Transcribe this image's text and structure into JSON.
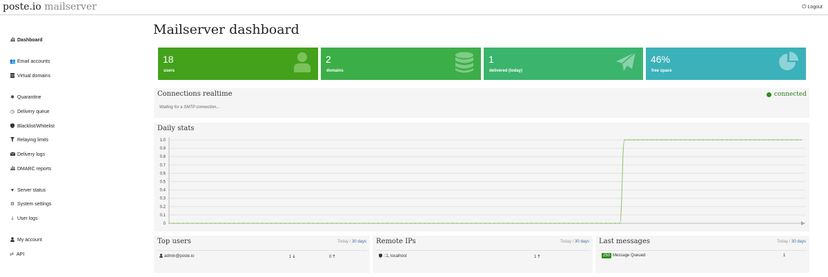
{
  "topbar": {
    "brand_main": "poste.io",
    "brand_sub": "mailserver",
    "logout_icon": "power-icon",
    "logout_label": "Logout"
  },
  "sidebar": {
    "items": [
      {
        "label": "Dashboard",
        "icon": "bar-chart-icon",
        "active": true
      },
      {
        "label": "Email accounts",
        "icon": "users-icon"
      },
      {
        "label": "Virtual domains",
        "icon": "server-icon"
      },
      {
        "label": "Quarantine",
        "icon": "bug-icon"
      },
      {
        "label": "Delivery queue",
        "icon": "clock-icon"
      },
      {
        "label": "Blacklist/Whitelist",
        "icon": "shield-icon"
      },
      {
        "label": "Relaying limits",
        "icon": "filter-icon"
      },
      {
        "label": "Delivery logs",
        "icon": "envelope-icon"
      },
      {
        "label": "DMARC reports",
        "icon": "bar-chart-icon"
      },
      {
        "label": "Server status",
        "icon": "heartbeat-icon"
      },
      {
        "label": "System settings",
        "icon": "cogs-icon"
      },
      {
        "label": "User logs",
        "icon": "download-icon"
      },
      {
        "label": "My account",
        "icon": "user-icon"
      },
      {
        "label": "API",
        "icon": "exchange-icon"
      }
    ]
  },
  "main": {
    "title": "Mailserver dashboard",
    "tiles": [
      {
        "value": "18",
        "label": "users",
        "icon": "user-icon",
        "color": "#43a11b"
      },
      {
        "value": "2",
        "label": "domains",
        "icon": "database-icon",
        "color": "#3cae47"
      },
      {
        "value": "1",
        "label": "delivered (today)",
        "icon": "paper-plane-icon",
        "color": "#3bb46d"
      },
      {
        "value": "46%",
        "label": "free space",
        "icon": "pie-chart-icon",
        "color": "#3bb1b9"
      }
    ],
    "connections": {
      "title": "Connections realtime",
      "status": "connected",
      "waiting": "Waiting for a SMTP connection..."
    },
    "daily_stats": {
      "title": "Daily stats"
    },
    "top_users": {
      "title": "Top users",
      "period_today": "Today",
      "period_sep": " / ",
      "period_30": "30 days",
      "rows": [
        {
          "name": "admin@poste.io",
          "count_in": "1",
          "count_out": "0"
        }
      ]
    },
    "remote_ips": {
      "title": "Remote IPs",
      "period_today": "Today",
      "period_sep": " / ",
      "period_30": "30 days",
      "rows": [
        {
          "address": "::1, localhost",
          "count": "1"
        }
      ]
    },
    "last_messages": {
      "title": "Last messages",
      "period_today": "Today",
      "period_sep": " / ",
      "period_30": "30 days",
      "rows": [
        {
          "code": "250",
          "text": "Message Queued",
          "count": "1"
        }
      ]
    }
  },
  "chart_data": {
    "type": "line",
    "title": "Daily stats",
    "y_ticks": [
      "0",
      "0.1",
      "0.2",
      "0.3",
      "0.4",
      "0.5",
      "0.6",
      "0.7",
      "0.8",
      "0.9",
      "1.0"
    ],
    "ylim": [
      0,
      1
    ],
    "grid": true,
    "series": [
      {
        "color": "#8fbf6f",
        "values": [
          0,
          0,
          0,
          0,
          0,
          0,
          0,
          0,
          0,
          0,
          0,
          0,
          0,
          0,
          0,
          0,
          0,
          0,
          0,
          0,
          0,
          0,
          0,
          0,
          0,
          0,
          0,
          0,
          0,
          0,
          0,
          0,
          0,
          0,
          0,
          0,
          0,
          0,
          0,
          0,
          0,
          0,
          0,
          0,
          0,
          0,
          0,
          0,
          0,
          0,
          0,
          0,
          0,
          0,
          0,
          0,
          0,
          0,
          0,
          0,
          0,
          0,
          0,
          0,
          0,
          0,
          0,
          0,
          0,
          0,
          0,
          0,
          0,
          0,
          0,
          0,
          0,
          0,
          0,
          0,
          0,
          0,
          0,
          0,
          0,
          0,
          0,
          0,
          0,
          0,
          0,
          0,
          0,
          0,
          0,
          0,
          0,
          0,
          1,
          1,
          1,
          1,
          1,
          1,
          1,
          1,
          1,
          1,
          1,
          1,
          1,
          1,
          1,
          1,
          1,
          1,
          1,
          1,
          1,
          1,
          1,
          1,
          1,
          1,
          1,
          1,
          1,
          1,
          1,
          1,
          1,
          1,
          1,
          1,
          1,
          1,
          1
        ]
      }
    ]
  }
}
